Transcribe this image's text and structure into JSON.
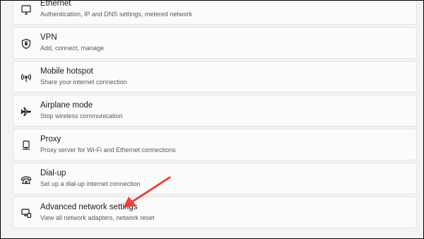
{
  "settings_items": [
    {
      "title": "Ethernet",
      "subtitle": "Authentication, IP and DNS settings, metered network",
      "icon": "monitor-icon"
    },
    {
      "title": "VPN",
      "subtitle": "Add, connect, manage",
      "icon": "shield-icon"
    },
    {
      "title": "Mobile hotspot",
      "subtitle": "Share your internet connection",
      "icon": "hotspot-icon"
    },
    {
      "title": "Airplane mode",
      "subtitle": "Stop wireless communication",
      "icon": "airplane-icon"
    },
    {
      "title": "Proxy",
      "subtitle": "Proxy server for Wi-Fi and Ethernet connections",
      "icon": "proxy-icon"
    },
    {
      "title": "Dial-up",
      "subtitle": "Set up a dial-up internet connection",
      "icon": "dialup-icon"
    },
    {
      "title": "Advanced network settings",
      "subtitle": "View all network adapters, network reset",
      "icon": "advanced-network-icon"
    }
  ],
  "colors": {
    "annotation_arrow": "#e8453c",
    "card_bg": "#fbfbfb",
    "page_bg": "#f3f3f3"
  }
}
